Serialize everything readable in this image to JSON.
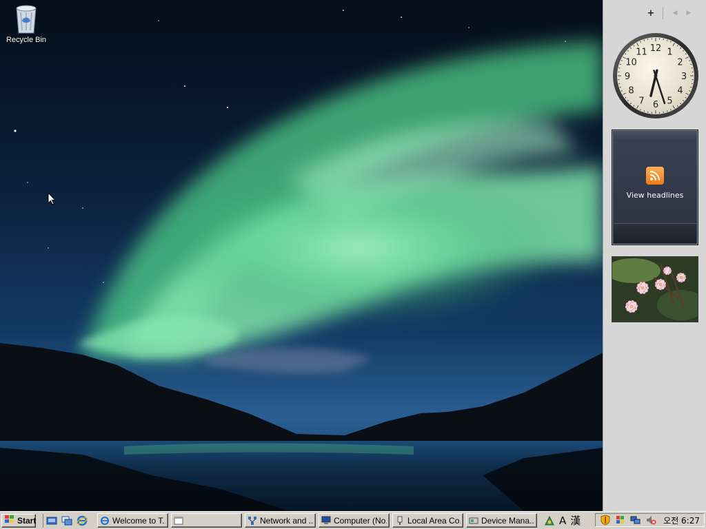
{
  "desktop": {
    "icons": [
      {
        "label": "Recycle Bin",
        "icon": "recycle-bin-icon"
      }
    ]
  },
  "sidebar": {
    "toolbar": {
      "add": "+",
      "prev": "◀",
      "next": "▶"
    },
    "clock": {
      "numerals": [
        "12",
        "1",
        "2",
        "3",
        "4",
        "5",
        "6",
        "7",
        "8",
        "9",
        "10",
        "11"
      ]
    },
    "feed": {
      "label": "View headlines",
      "icon": "rss-icon"
    },
    "slideshow": {
      "icon": "flower-photo"
    }
  },
  "taskbar": {
    "start_label": "Start",
    "quick_launch": [
      "show-desktop-icon",
      "switch-windows-icon",
      "internet-explorer-icon"
    ],
    "tasks": [
      {
        "label": "Welcome to T...",
        "icon": "ie-icon"
      },
      {
        "label": "",
        "icon": "window-icon"
      },
      {
        "label": "Network and ...",
        "icon": "network-icon"
      },
      {
        "label": "Computer (No...",
        "icon": "computer-icon"
      },
      {
        "label": "Local Area Co...",
        "icon": "connection-icon"
      },
      {
        "label": "Device Mana...",
        "icon": "device-manager-icon"
      }
    ],
    "language_bar": {
      "mode": "A",
      "hanja": "漢"
    },
    "tray": {
      "time": "오전 6:27"
    }
  },
  "colors": {
    "aurora": "#7fe3a8",
    "sky": "#0a1a33",
    "taskbar": "#d4d0c8",
    "sidebar": "#d6d6d6"
  }
}
